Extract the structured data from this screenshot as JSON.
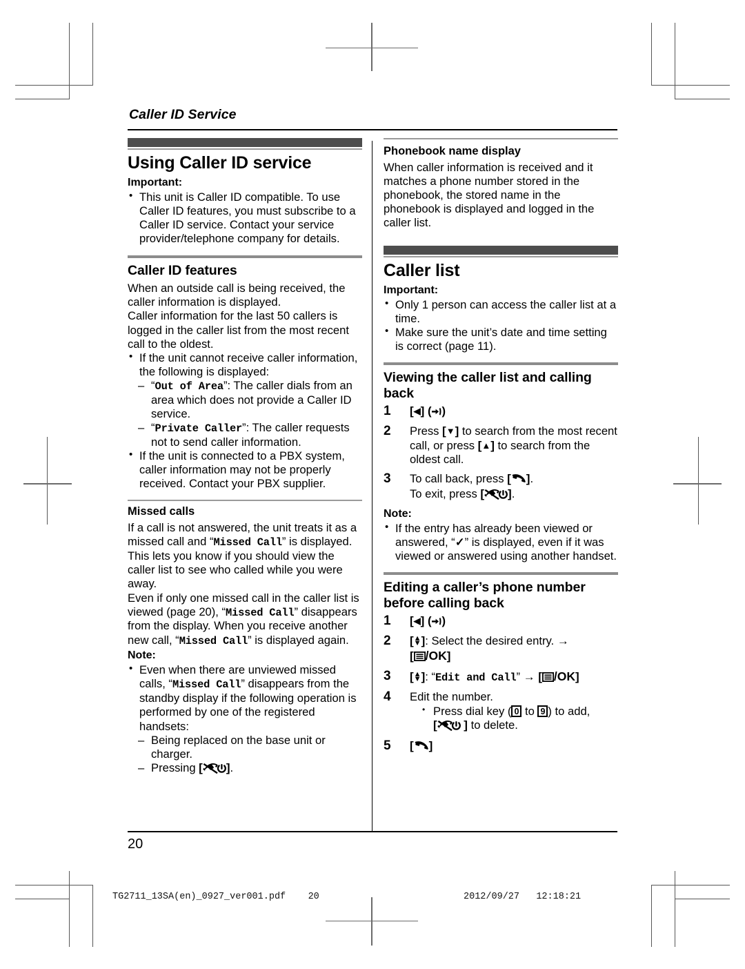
{
  "running_head": "Caller ID Service",
  "page_number": "20",
  "footer": {
    "file": "TG2711_13SA(en)_0927_ver001.pdf",
    "page": "20",
    "date": "2012/09/27",
    "time": "12:18:21"
  },
  "left_column": {
    "section_title": "Using Caller ID service",
    "important_label": "Important:",
    "important_items": [
      "This unit is Caller ID compatible. To use Caller ID features, you must subscribe to a Caller ID service. Contact your service provider/telephone company for details."
    ],
    "features": {
      "title": "Caller ID features",
      "para1": "When an outside call is being received, the caller information is displayed.",
      "para2": "Caller information for the last 50 callers is logged in the caller list from the most recent call to the oldest.",
      "bullet1": "If the unit cannot receive caller information, the following is displayed:",
      "dash1_display": "Out of Area",
      "dash1_text": ": The caller dials from an area which does not provide a Caller ID service.",
      "dash2_display": "Private Caller",
      "dash2_text": ": The caller requests not to send caller information.",
      "bullet2": "If the unit is connected to a PBX system, caller information may not be properly received. Contact your PBX supplier."
    },
    "missed": {
      "title": "Missed calls",
      "para1_a": "If a call is not answered, the unit treats it as a missed call and “",
      "para1_display": "Missed Call",
      "para1_b": "” is displayed. This lets you know if you should view the caller list to see who called while you were away.",
      "para2_a": "Even if only one missed call in the caller list is viewed (page 20), “",
      "para2_display": "Missed Call",
      "para2_b": "” disappears from the display. When you receive another new call, “",
      "para2_display2": "Missed Call",
      "para2_c": "” is displayed again.",
      "note_label": "Note:",
      "note_a": "Even when there are unviewed missed calls, “",
      "note_display": "Missed Call",
      "note_b": "” disappears from the standby display if the following operation is performed by one of the registered handsets:",
      "note_dash1": "Being replaced on the base unit or charger.",
      "note_dash2_pre": "Pressing ",
      "note_dash2_post": "."
    }
  },
  "right_column": {
    "phonebook": {
      "title": "Phonebook name display",
      "para": "When caller information is received and it matches a phone number stored in the phonebook, the stored name in the phonebook is displayed and logged in the caller list."
    },
    "caller_list": {
      "section_title": "Caller list",
      "important_label": "Important:",
      "important_items": [
        "Only 1 person can access the caller list at a time.",
        "Make sure the unit’s date and time setting is correct (page 11)."
      ]
    },
    "viewing": {
      "title": "Viewing the caller list and calling back",
      "step1_num": "1",
      "step2_num": "2",
      "step2_a": "Press ",
      "step2_b": " to search from the most recent call, or press ",
      "step2_c": " to search from the oldest call.",
      "step3_num": "3",
      "step3_a": "To call back, press ",
      "step3_b": ".",
      "step3_c": "To exit, press ",
      "step3_d": ".",
      "note_label": "Note:",
      "note_a": "If the entry has already been viewed or answered, “",
      "note_check": "✓",
      "note_b": "” is displayed, even if it was viewed or answered using another handset."
    },
    "editing": {
      "title": "Editing a caller’s phone number before calling back",
      "step1_num": "1",
      "step2_num": "2",
      "step2_text": ": Select the desired entry. ",
      "step3_num": "3",
      "step3_quote_open": ": “",
      "step3_display": "Edit and Call",
      "step3_quote_close": "” ",
      "step4_num": "4",
      "step4_text": "Edit the number.",
      "step4_bullet_a": "Press dial key (",
      "step4_key_from": "0",
      "step4_key_to": "9",
      "step4_bullet_b": ") to add,",
      "step4_bullet_c": " to delete.",
      "step5_num": "5",
      "ok_label": "/OK"
    }
  },
  "icons": {
    "left_arrow_key": "left-arrow-key",
    "ring_key": "ring-indicator",
    "down_arrow_key": "down-arrow-key",
    "up_arrow_key": "up-arrow-key",
    "updown_key": "up-down-select-key",
    "talk_key": "talk-handset-key",
    "offhook_power_key": "off-hook-power-key",
    "menu_ok_key": "menu-ok-key",
    "check_mark": "check-mark"
  },
  "colors": {
    "bar": "#4d4d4d",
    "rule_grey": "#8c8c8c",
    "text": "#000000"
  }
}
